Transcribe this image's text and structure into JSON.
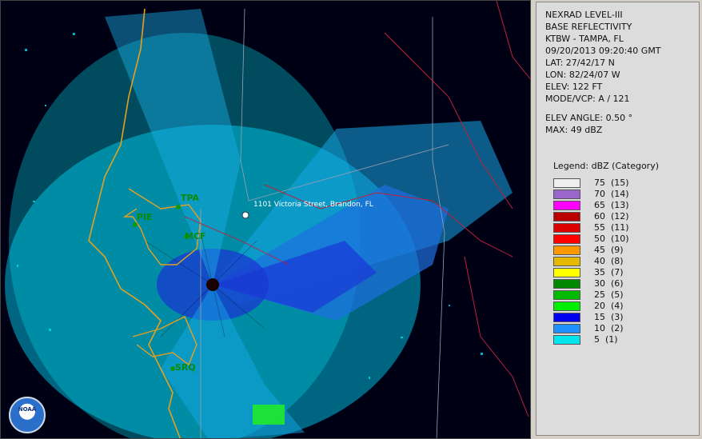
{
  "info": {
    "lines": [
      "NEXRAD LEVEL-III",
      "BASE REFLECTIVITY",
      "KTBW - TAMPA, FL",
      "09/20/2013 09:20:40 GMT",
      "LAT: 27/42/17 N",
      "LON: 82/24/07 W",
      "ELEV: 122 FT",
      "MODE/VCP: A / 121"
    ],
    "elev_angle": "ELEV ANGLE: 0.50 °",
    "max": "MAX: 49 dBZ"
  },
  "legend": {
    "title": "Legend: dBZ (Category)",
    "entries": [
      {
        "label": "75  (15)",
        "color": "#eeeeee"
      },
      {
        "label": "70  (14)",
        "color": "#9966cc"
      },
      {
        "label": "65  (13)",
        "color": "#ff00ff"
      },
      {
        "label": "60  (12)",
        "color": "#bb0000"
      },
      {
        "label": "55  (11)",
        "color": "#dd0000"
      },
      {
        "label": "50  (10)",
        "color": "#ff0000"
      },
      {
        "label": "45  (9)",
        "color": "#ff9900"
      },
      {
        "label": "40  (8)",
        "color": "#e6b800"
      },
      {
        "label": "35  (7)",
        "color": "#ffff00"
      },
      {
        "label": "30  (6)",
        "color": "#008800"
      },
      {
        "label": "25  (5)",
        "color": "#00bb00"
      },
      {
        "label": "20  (4)",
        "color": "#00ee00"
      },
      {
        "label": "15  (3)",
        "color": "#0000ee"
      },
      {
        "label": "10  (2)",
        "color": "#1e90ff"
      },
      {
        "label": "5  (1)",
        "color": "#00e5ee"
      }
    ]
  },
  "map": {
    "marker_label": "1101 Victoria Street, Brandon, FL",
    "cities": [
      "TPA",
      "PIE",
      "MCF",
      "SRQ"
    ],
    "logo_text": "NOAA"
  }
}
